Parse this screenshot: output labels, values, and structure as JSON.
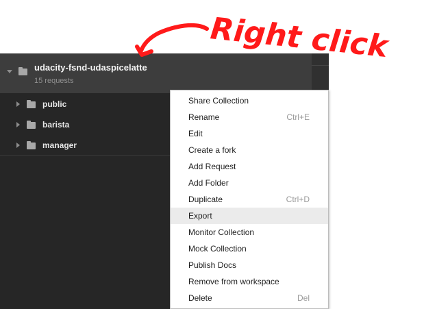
{
  "collection": {
    "name": "udacity-fsnd-udaspicelatte",
    "subtitle": "15 requests",
    "folders": [
      {
        "label": "public"
      },
      {
        "label": "barista"
      },
      {
        "label": "manager"
      }
    ]
  },
  "context_menu": {
    "highlighted": "Export",
    "items": [
      {
        "label": "Share Collection",
        "shortcut": ""
      },
      {
        "label": "Rename",
        "shortcut": "Ctrl+E"
      },
      {
        "label": "Edit",
        "shortcut": ""
      },
      {
        "label": "Create a fork",
        "shortcut": ""
      },
      {
        "label": "Add Request",
        "shortcut": ""
      },
      {
        "label": "Add Folder",
        "shortcut": ""
      },
      {
        "label": "Duplicate",
        "shortcut": "Ctrl+D"
      },
      {
        "label": "Export",
        "shortcut": ""
      },
      {
        "label": "Monitor Collection",
        "shortcut": ""
      },
      {
        "label": "Mock Collection",
        "shortcut": ""
      },
      {
        "label": "Publish Docs",
        "shortcut": ""
      },
      {
        "label": "Remove from workspace",
        "shortcut": ""
      },
      {
        "label": "Delete",
        "shortcut": "Del"
      }
    ]
  },
  "annotation": {
    "text": "Right click",
    "color": "#ff1a1a"
  },
  "icons": [
    "caret-down-icon",
    "folder-icon",
    "caret-right-icon"
  ]
}
